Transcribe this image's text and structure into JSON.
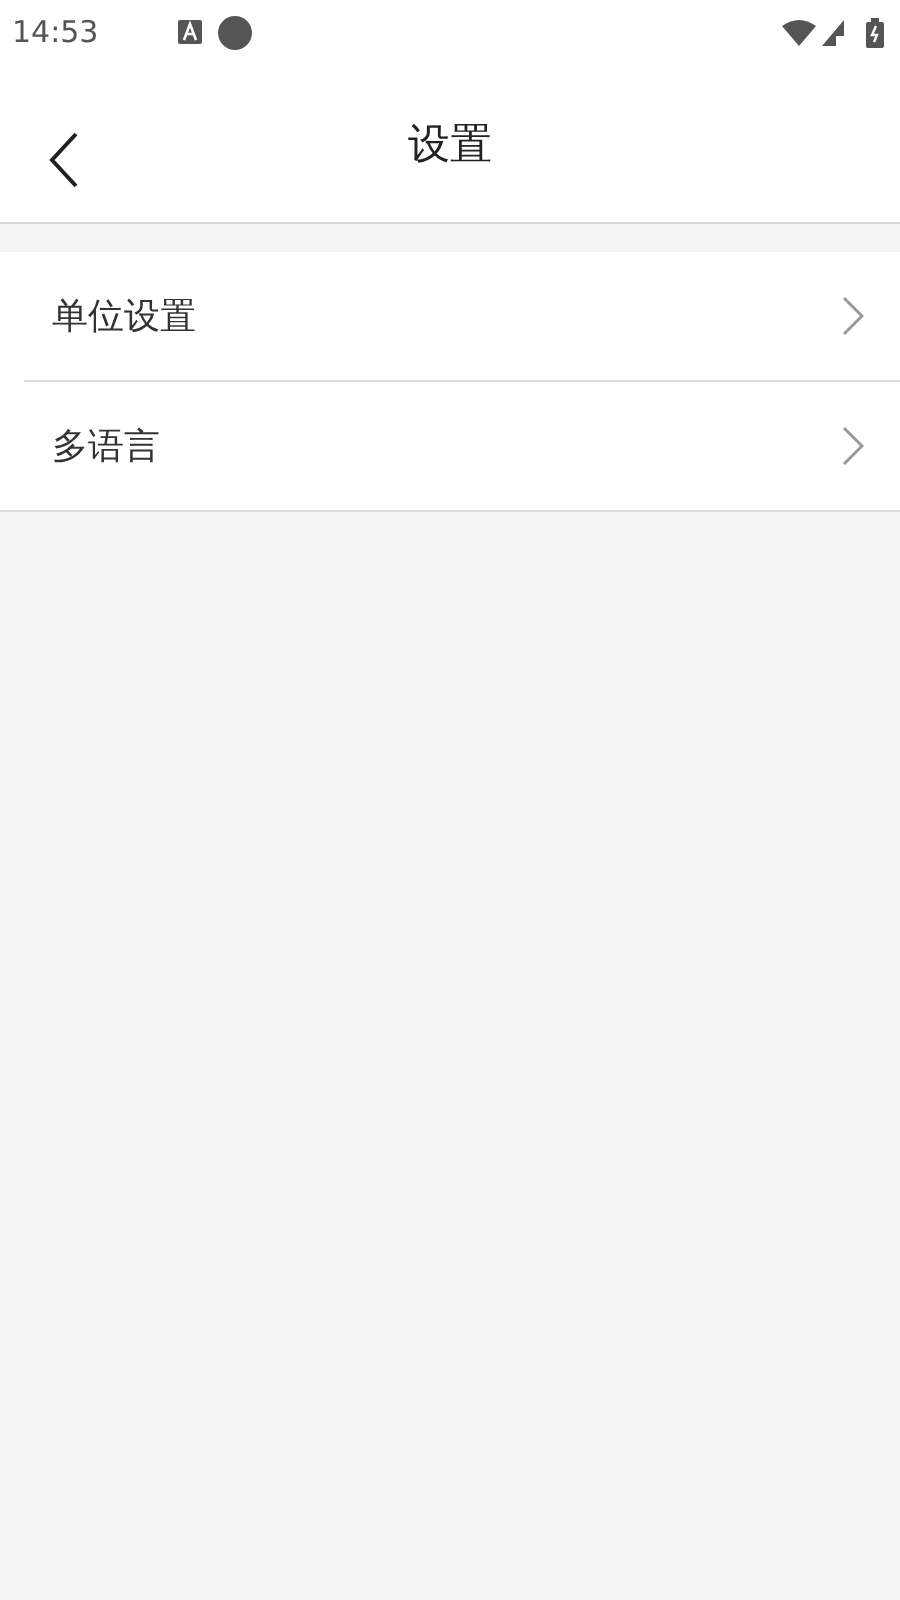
{
  "status_bar": {
    "time": "14:53"
  },
  "header": {
    "title": "设置"
  },
  "items": [
    {
      "label": "单位设置"
    },
    {
      "label": "多语言"
    }
  ]
}
